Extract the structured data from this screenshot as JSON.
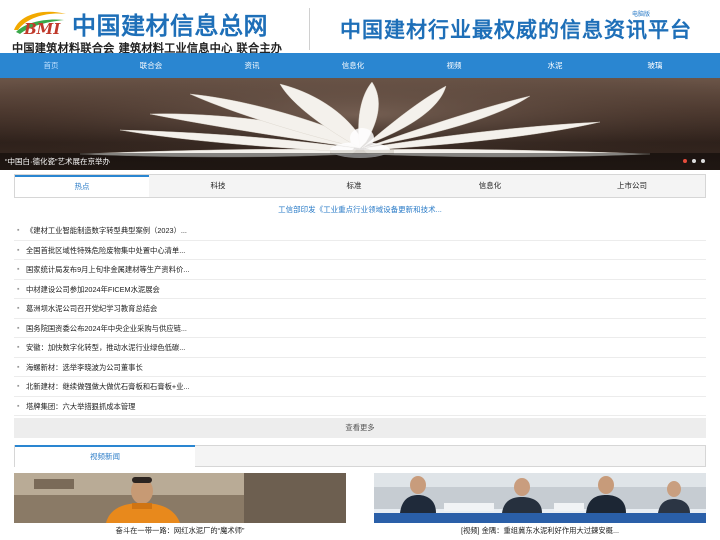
{
  "header": {
    "logo_mark": "BMI",
    "site_name": "中国建材信息总网",
    "organizers": "中国建筑材料联合会 建筑材料工业信息中心 联合主办",
    "slogan": "中国建材行业最权威的信息资讯平台",
    "pc_link": "电脑版"
  },
  "nav": {
    "items": [
      "首页",
      "联合会",
      "资讯",
      "信息化",
      "视频",
      "水泥",
      "玻璃"
    ]
  },
  "banner": {
    "caption": "“中国白·德化瓷”艺术展在京举办",
    "slide_count": 3,
    "active_slide": 1
  },
  "tabs": {
    "items": [
      "热点",
      "科技",
      "标准",
      "信息化",
      "上市公司"
    ],
    "active": 0
  },
  "headline": "工信部印发《工业重点行业领域设备更新和技术...",
  "news": [
    "《建材工业智能制造数字转型典型案例（2023）...",
    "全国首批区域性特殊危险废物集中处置中心清单...",
    "国家统计局发布9月上旬非金属建材等生产资料价...",
    "中材建设公司参加2024年FICEM水泥展会",
    "葛洲坝水泥公司召开党纪学习教育总结会",
    "国务院国资委公布2024年中央企业采购与供应链...",
    "安徽：加快数字化转型，推动水泥行业绿色低碳...",
    "海螺新材：选举李晓波为公司董事长",
    "北新建材：继续做强做大做优石膏板和石膏板+业...",
    "塔牌集团：六大举措狠抓成本管理"
  ],
  "more_label": "查看更多",
  "video_section": {
    "tab_label": "视频新闻",
    "videos": [
      {
        "caption": "奋斗在一带一路：网红水泥厂的“魔术师”"
      },
      {
        "caption": "[视频] 金隅：重组冀东水泥利好作用大过鍊安概..."
      }
    ]
  },
  "colors": {
    "brand_blue": "#2a86d1",
    "link_blue": "#2a7bc7",
    "logo_red": "#c0392b"
  }
}
